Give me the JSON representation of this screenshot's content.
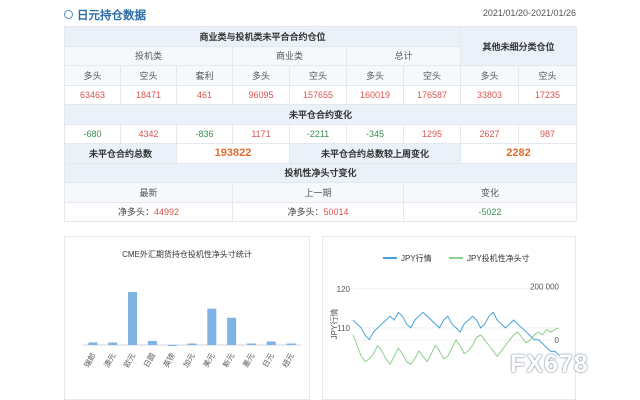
{
  "header": {
    "title": "日元持仓数据",
    "date_range": "2021/01/20-2021/01/26"
  },
  "table": {
    "group_title": "商业类与投机类未平合合约仓位",
    "other_title": "其他未细分类仓位",
    "spec_title": "投机类",
    "comm_title": "商业类",
    "total_title": "总计",
    "col_long": "多头",
    "col_short": "空头",
    "col_spread": "套利",
    "values": [
      "63463",
      "18471",
      "461",
      "96095",
      "157655",
      "160019",
      "176587",
      "33803",
      "17235"
    ],
    "change_title": "未平仓合约变化",
    "changes": [
      "-680",
      "4342",
      "-836",
      "1171",
      "-2211",
      "-345",
      "1295",
      "2627",
      "987"
    ],
    "oi_total_label": "未平仓合约总数",
    "oi_total_value": "193822",
    "oi_change_label": "未平仓合约总数较上周变化",
    "oi_change_value": "2282",
    "net_title": "投机性净头寸变化",
    "latest_label": "最新",
    "prev_label": "上一期",
    "change_label": "变化",
    "net_label_latest": "净多头：",
    "net_latest": "44992",
    "net_label_prev": "净多头：",
    "net_prev": "50014",
    "net_change": "-5022"
  },
  "bar_chart": {
    "title": "CME外汇期货持仓投机性净头寸统计",
    "chart_data": {
      "type": "bar",
      "categories": [
        "瑞郎",
        "澳元",
        "欧元",
        "日圆",
        "英镑",
        "加元",
        "美元",
        "新元",
        "墨元",
        "日元",
        "纽元"
      ],
      "values": [
        0.5,
        0.5,
        10.5,
        0.8,
        -0.2,
        0.3,
        7.2,
        5.4,
        0.3,
        0.7,
        0.3
      ],
      "color": "#7fb3e3"
    }
  },
  "line_chart": {
    "series": [
      {
        "name": "JPY行情",
        "color": "#4aa0d8"
      },
      {
        "name": "JPY投机性净头寸",
        "color": "#8dd08a"
      }
    ],
    "left_ticks": [
      "120",
      "110"
    ],
    "right_ticks": [
      "200 000",
      "0"
    ],
    "ylabel": "JPY行情",
    "chart_data": {
      "type": "line",
      "x": [
        0,
        1,
        2,
        3,
        4,
        5,
        6,
        7,
        8,
        9,
        10,
        11,
        12,
        13,
        14,
        15,
        16,
        17,
        18,
        19,
        20,
        21,
        22,
        23,
        24,
        25,
        26,
        27,
        28,
        29,
        30,
        31,
        32,
        33,
        34,
        35,
        36,
        37,
        38,
        39,
        40,
        41,
        42,
        43,
        44,
        45,
        46,
        47,
        48,
        49,
        50
      ],
      "series": [
        {
          "name": "JPY行情",
          "axis": "left",
          "values": [
            112,
            111,
            110,
            108,
            107,
            109,
            110,
            111,
            112,
            113,
            112,
            114,
            113,
            111,
            110,
            112,
            113,
            114,
            113,
            112,
            111,
            110,
            112,
            113,
            111,
            110,
            109,
            111,
            112,
            113,
            112,
            110,
            111,
            113,
            114,
            112,
            111,
            110,
            111,
            112,
            111,
            110,
            109,
            108,
            107,
            107,
            106,
            105,
            104,
            104,
            103
          ]
        },
        {
          "name": "JPY投机性净头寸",
          "axis": "right",
          "values": [
            20000,
            -20000,
            -60000,
            -80000,
            -70000,
            -50000,
            -20000,
            -40000,
            -70000,
            -90000,
            -60000,
            -30000,
            -50000,
            -80000,
            -90000,
            -70000,
            -40000,
            -60000,
            -80000,
            -50000,
            -20000,
            -40000,
            -70000,
            -60000,
            -30000,
            0,
            -20000,
            -50000,
            -40000,
            -20000,
            10000,
            20000,
            0,
            -20000,
            -40000,
            -60000,
            -40000,
            -20000,
            0,
            20000,
            30000,
            10000,
            -10000,
            0,
            20000,
            30000,
            20000,
            40000,
            30000,
            40000,
            45000
          ]
        }
      ],
      "left_range": [
        100,
        122
      ],
      "right_range": [
        -100000,
        220000
      ]
    }
  },
  "watermark": "FX678"
}
